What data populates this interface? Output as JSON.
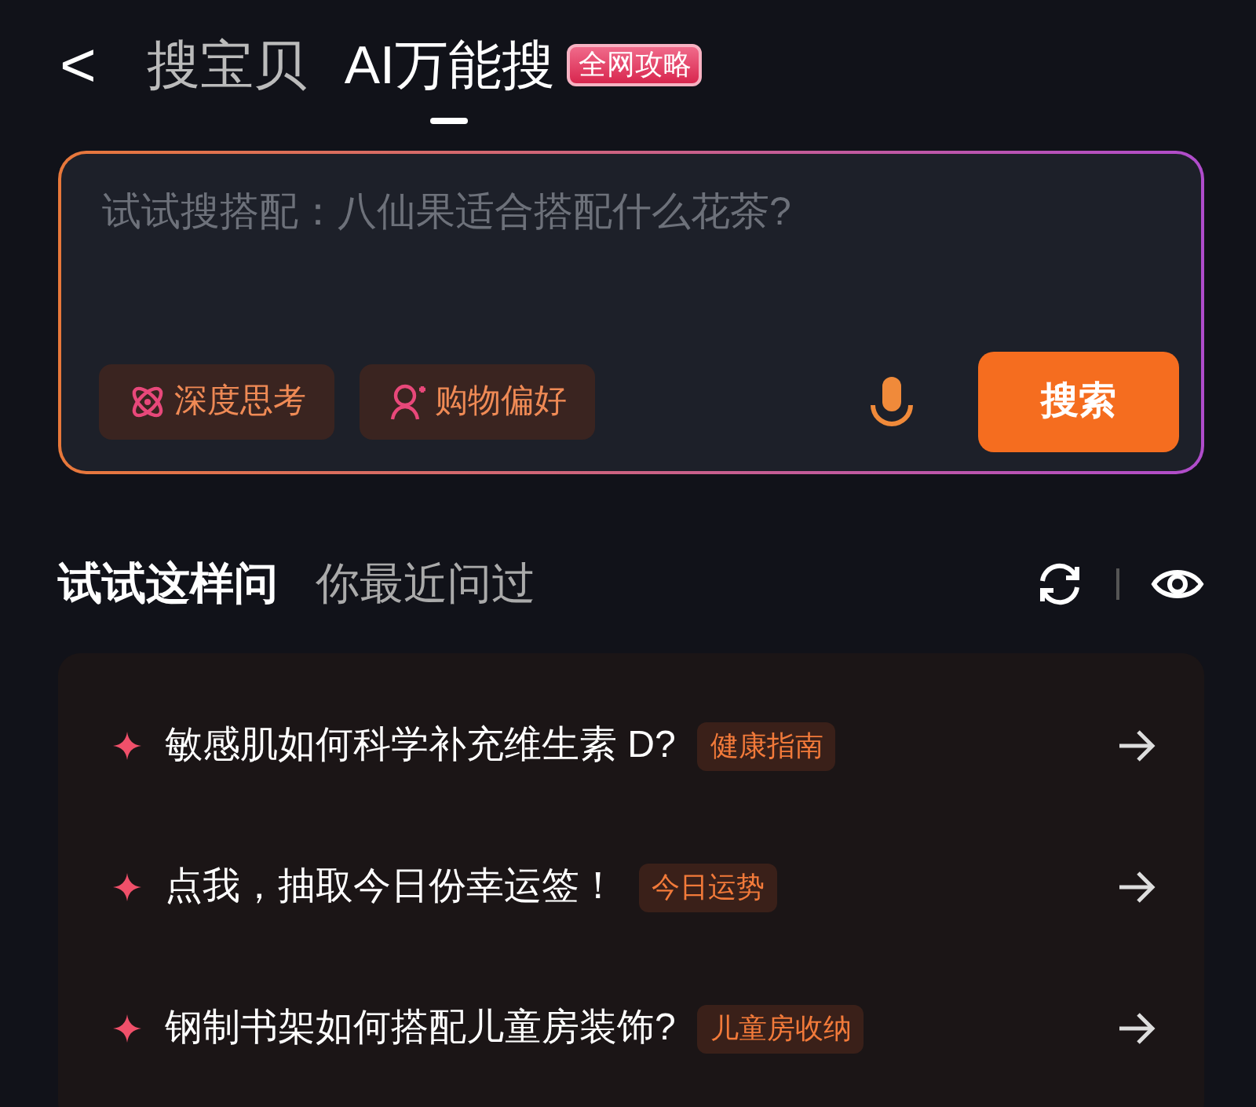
{
  "header": {
    "back": "<",
    "tabs": [
      {
        "label": "搜宝贝",
        "selected": false
      },
      {
        "label": "AI万能搜",
        "selected": true,
        "badge": "全网攻略"
      }
    ]
  },
  "search": {
    "placeholder": "试试搜搭配：八仙果适合搭配什么花茶?",
    "chips": [
      {
        "kind": "think",
        "label": "深度思考"
      },
      {
        "kind": "pref",
        "label": "购物偏好"
      }
    ],
    "button": "搜索"
  },
  "section_tabs": [
    {
      "label": "试试这样问",
      "selected": true
    },
    {
      "label": "你最近问过",
      "selected": false
    }
  ],
  "suggestions": [
    {
      "text": "敏感肌如何科学补充维生素 D?",
      "tag": "健康指南"
    },
    {
      "text": "点我，抽取今日份幸运签！",
      "tag": "今日运势"
    },
    {
      "text": "钢制书架如何搭配儿童房装饰?",
      "tag": "儿童房收纳"
    }
  ]
}
